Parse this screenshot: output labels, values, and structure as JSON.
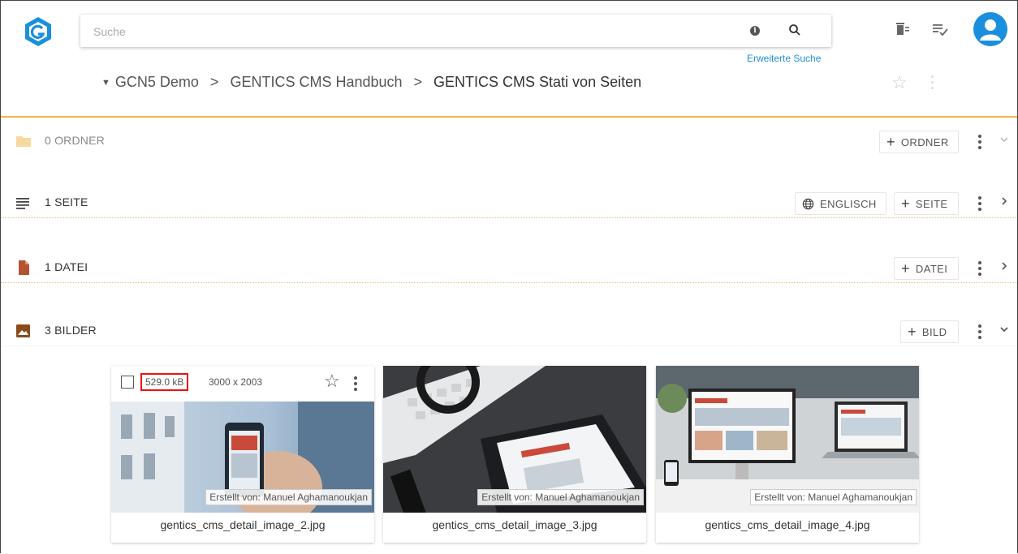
{
  "search": {
    "placeholder": "Suche",
    "advanced_label": "Erweiterte Suche"
  },
  "breadcrumb": {
    "items": [
      "GCN5 Demo",
      "GENTICS CMS Handbuch",
      "GENTICS CMS Stati von Seiten"
    ],
    "separator": ">"
  },
  "sections": {
    "folders": {
      "title": "0 ORDNER",
      "add_label": "ORDNER"
    },
    "pages": {
      "title": "1 SEITE",
      "language_label": "ENGLISCH",
      "add_label": "SEITE"
    },
    "files": {
      "title": "1 DATEI",
      "add_label": "DATEI"
    },
    "images": {
      "title": "3 BILDER",
      "add_label": "BILD"
    }
  },
  "images": [
    {
      "filename": "gentics_cms_detail_image_2.jpg",
      "author": "Erstellt von: Manuel Aghamanoukjan",
      "size": "529.0 kB",
      "dimensions": "3000 x 2003"
    },
    {
      "filename": "gentics_cms_detail_image_3.jpg",
      "author": "Erstellt von: Manuel Aghamanoukjan"
    },
    {
      "filename": "gentics_cms_detail_image_4.jpg",
      "author": "Erstellt von: Manuel Aghamanoukjan"
    }
  ],
  "colors": {
    "accent": "#1a8fdd",
    "divider": "#f0b84a",
    "folder": "#f5d9a0",
    "file": "#b5522f",
    "image": "#8a4a1a",
    "highlight": "#e11111"
  }
}
